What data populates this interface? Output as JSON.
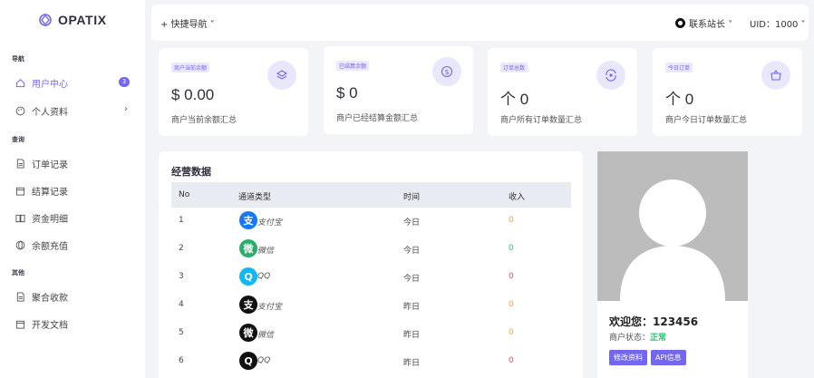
{
  "brand": {
    "name": "OPATIX"
  },
  "sidebar": {
    "sections": [
      "导航",
      "查询",
      "其他"
    ],
    "items": [
      {
        "label": "用户中心",
        "badge": "3",
        "icon": "home-icon"
      },
      {
        "label": "个人资料",
        "icon": "palette-icon"
      },
      {
        "label": "订单记录",
        "icon": "file-icon"
      },
      {
        "label": "结算记录",
        "icon": "calendar-icon"
      },
      {
        "label": "资金明细",
        "icon": "book-icon"
      },
      {
        "label": "余额充值",
        "icon": "globe-icon"
      },
      {
        "label": "聚合收款",
        "icon": "file-icon"
      },
      {
        "label": "开发文档",
        "icon": "calendar-icon"
      }
    ]
  },
  "topbar": {
    "quick_nav": "+ 快捷导航 ˅",
    "contact": "联系站长 ˅",
    "uid": "UID：1000 ˅"
  },
  "stats": [
    {
      "badge": "商户当前余额",
      "value": "$ 0.00",
      "desc": "商户当前余额汇总",
      "icon": "layers-icon"
    },
    {
      "badge": "已结算余额",
      "value": "$ 0",
      "desc": "商户已经结算金额汇总",
      "icon": "dollar-circle-icon"
    },
    {
      "badge": "订单总数",
      "value": "个 0",
      "desc": "商户所有订单数量汇总",
      "icon": "refresh-eye-icon"
    },
    {
      "badge": "今日订单",
      "value": "个 0",
      "desc": "商户今日订单数量汇总",
      "icon": "basket-icon"
    }
  ],
  "table": {
    "title": "经营数据",
    "headers": [
      "No",
      "通道类型",
      "时间",
      "收入"
    ],
    "rows": [
      {
        "no": "1",
        "channel": "支付宝",
        "time": "今日",
        "income": "0",
        "color": "#1677ff",
        "glyph": "支",
        "income_color": "#ff9f43"
      },
      {
        "no": "2",
        "channel": "微信",
        "time": "今日",
        "income": "0",
        "color": "#2aae67",
        "glyph": "微",
        "income_color": "#28c76f"
      },
      {
        "no": "3",
        "channel": "QQ",
        "time": "今日",
        "income": "0",
        "color": "#12b7f5",
        "glyph": "Q",
        "income_color": "#ea5455"
      },
      {
        "no": "4",
        "channel": "支付宝",
        "time": "昨日",
        "income": "0",
        "color": "#111111",
        "glyph": "支",
        "income_color": "#ff9f43"
      },
      {
        "no": "5",
        "channel": "微信",
        "time": "昨日",
        "income": "0",
        "color": "#111111",
        "glyph": "微",
        "income_color": "#ff9f43"
      },
      {
        "no": "6",
        "channel": "QQ",
        "time": "昨日",
        "income": "0",
        "color": "#111111",
        "glyph": "Q",
        "income_color": "#ea5455"
      }
    ]
  },
  "profile": {
    "welcome": "欢迎您：123456",
    "status_label": "商户状态：",
    "status_value": "正常",
    "edit_button": "修改资料",
    "api_button": "API信息"
  },
  "colors": {
    "accent": "#7367f0",
    "success": "#28c76f"
  }
}
